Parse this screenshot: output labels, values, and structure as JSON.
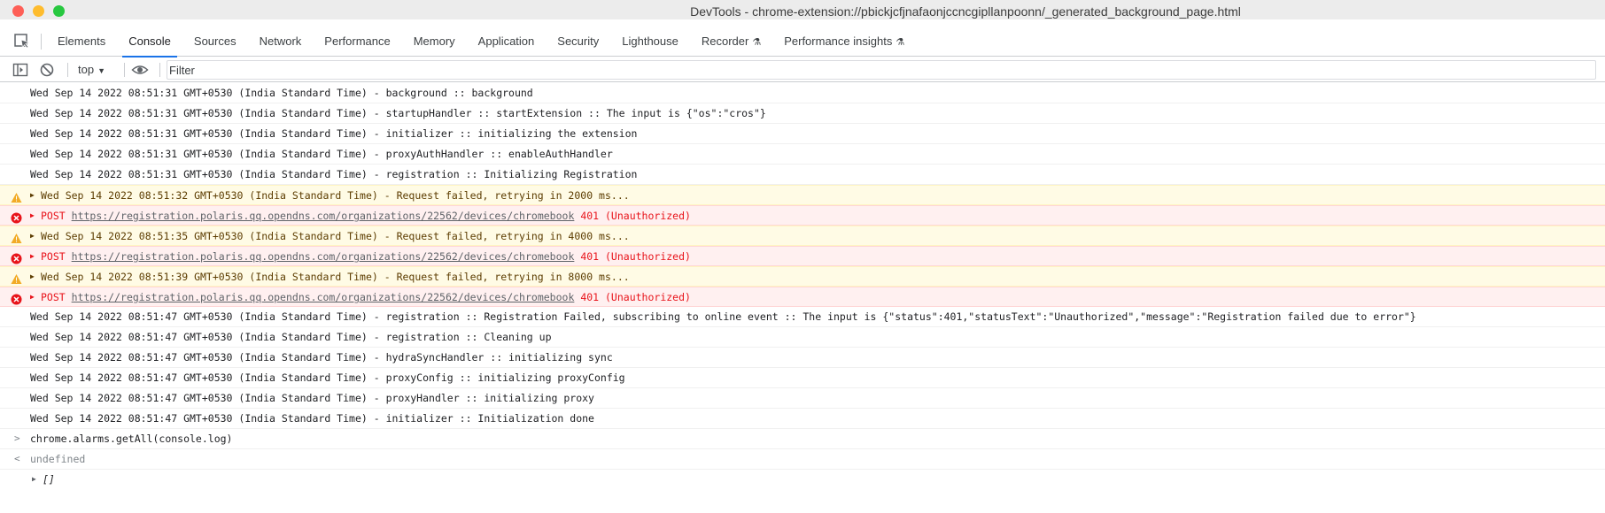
{
  "window": {
    "title": "DevTools - chrome-extension://pbickjcfjnafaonjccncgipllanpoonn/_generated_background_page.html"
  },
  "tabs": [
    {
      "label": "Elements",
      "active": false,
      "experimental": false
    },
    {
      "label": "Console",
      "active": true,
      "experimental": false
    },
    {
      "label": "Sources",
      "active": false,
      "experimental": false
    },
    {
      "label": "Network",
      "active": false,
      "experimental": false
    },
    {
      "label": "Performance",
      "active": false,
      "experimental": false
    },
    {
      "label": "Memory",
      "active": false,
      "experimental": false
    },
    {
      "label": "Application",
      "active": false,
      "experimental": false
    },
    {
      "label": "Security",
      "active": false,
      "experimental": false
    },
    {
      "label": "Lighthouse",
      "active": false,
      "experimental": false
    },
    {
      "label": "Recorder",
      "active": false,
      "experimental": true
    },
    {
      "label": "Performance insights",
      "active": false,
      "experimental": true
    }
  ],
  "toolbar": {
    "context": "top",
    "filter_placeholder": "Filter"
  },
  "colors": {
    "accent": "#1a73e8",
    "warning_bg": "#fffbe5",
    "error_bg": "#fff0f0",
    "error_text": "#e8131a"
  },
  "console": {
    "messages": [
      {
        "level": "log",
        "text": "Wed Sep 14 2022 08:51:31 GMT+0530 (India Standard Time) - background :: background"
      },
      {
        "level": "log",
        "text": "Wed Sep 14 2022 08:51:31 GMT+0530 (India Standard Time) - startupHandler :: startExtension :: The input is {\"os\":\"cros\"}"
      },
      {
        "level": "log",
        "text": "Wed Sep 14 2022 08:51:31 GMT+0530 (India Standard Time) - initializer :: initializing the extension"
      },
      {
        "level": "log",
        "text": "Wed Sep 14 2022 08:51:31 GMT+0530 (India Standard Time) - proxyAuthHandler :: enableAuthHandler"
      },
      {
        "level": "log",
        "text": "Wed Sep 14 2022 08:51:31 GMT+0530 (India Standard Time) - registration :: Initializing Registration"
      },
      {
        "level": "warn",
        "text": "Wed Sep 14 2022 08:51:32 GMT+0530 (India Standard Time) - Request failed, retrying in 2000 ms..."
      },
      {
        "level": "error",
        "method": "POST",
        "url": "https://registration.polaris.qq.opendns.com/organizations/22562/devices/chromebook",
        "status": "401 (Unauthorized)"
      },
      {
        "level": "warn",
        "text": "Wed Sep 14 2022 08:51:35 GMT+0530 (India Standard Time) - Request failed, retrying in 4000 ms..."
      },
      {
        "level": "error",
        "method": "POST",
        "url": "https://registration.polaris.qq.opendns.com/organizations/22562/devices/chromebook",
        "status": "401 (Unauthorized)"
      },
      {
        "level": "warn",
        "text": "Wed Sep 14 2022 08:51:39 GMT+0530 (India Standard Time) - Request failed, retrying in 8000 ms..."
      },
      {
        "level": "error",
        "method": "POST",
        "url": "https://registration.polaris.qq.opendns.com/organizations/22562/devices/chromebook",
        "status": "401 (Unauthorized)"
      },
      {
        "level": "log",
        "text": "Wed Sep 14 2022 08:51:47 GMT+0530 (India Standard Time) - registration :: Registration Failed, subscribing to online event :: The input is {\"status\":401,\"statusText\":\"Unauthorized\",\"message\":\"Registration failed due to error\"}"
      },
      {
        "level": "log",
        "text": "Wed Sep 14 2022 08:51:47 GMT+0530 (India Standard Time) - registration :: Cleaning up"
      },
      {
        "level": "log",
        "text": "Wed Sep 14 2022 08:51:47 GMT+0530 (India Standard Time) - hydraSyncHandler :: initializing sync"
      },
      {
        "level": "log",
        "text": "Wed Sep 14 2022 08:51:47 GMT+0530 (India Standard Time) - proxyConfig :: initializing proxyConfig"
      },
      {
        "level": "log",
        "text": "Wed Sep 14 2022 08:51:47 GMT+0530 (India Standard Time) - proxyHandler :: initializing proxy"
      },
      {
        "level": "log",
        "text": "Wed Sep 14 2022 08:51:47 GMT+0530 (India Standard Time) - initializer :: Initialization done"
      }
    ],
    "input": {
      "prompt": ">",
      "text": "chrome.alarms.getAll(console.log)"
    },
    "output": {
      "prompt": "<",
      "text": "undefined"
    },
    "array_result": "[]"
  }
}
